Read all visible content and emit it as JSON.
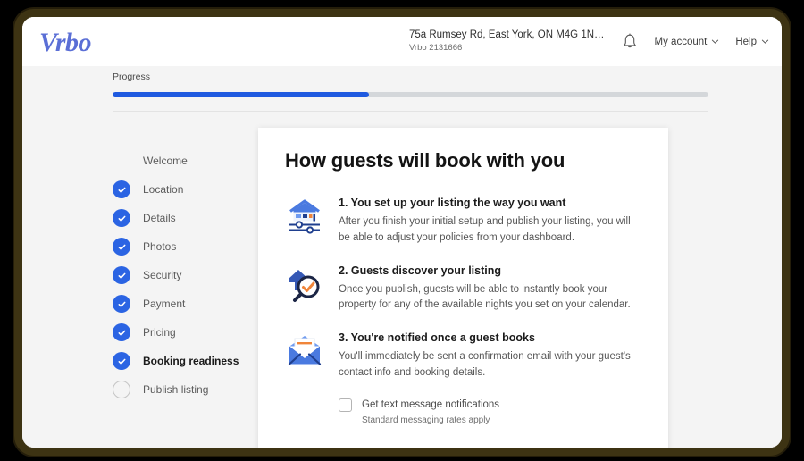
{
  "brand": {
    "name": "Vrbo"
  },
  "header": {
    "listing_address": "75a Rumsey Rd, East York, ON M4G 1N…",
    "listing_id": "Vrbo 2131666",
    "notifications_icon": "bell-icon",
    "account_menu": "My account",
    "help_menu": "Help"
  },
  "progress": {
    "label": "Progress",
    "percent": 43
  },
  "sidebar": {
    "items": [
      {
        "label": "Welcome",
        "state": "none"
      },
      {
        "label": "Location",
        "state": "done"
      },
      {
        "label": "Details",
        "state": "done"
      },
      {
        "label": "Photos",
        "state": "done"
      },
      {
        "label": "Security",
        "state": "done"
      },
      {
        "label": "Payment",
        "state": "done"
      },
      {
        "label": "Pricing",
        "state": "done"
      },
      {
        "label": "Booking readiness",
        "state": "done",
        "current": true
      },
      {
        "label": "Publish listing",
        "state": "todo"
      }
    ]
  },
  "main": {
    "title": "How guests will book with you",
    "steps": [
      {
        "icon": "house-sliders-icon",
        "title": "1. You set up your listing the way you want",
        "desc": "After you finish your initial setup and publish your listing, you will be able to adjust your policies from your dashboard."
      },
      {
        "icon": "house-search-check-icon",
        "title": "2. Guests discover your listing",
        "desc": "Once you publish, guests will be able to instantly book your property for any of the available nights you set on your calendar."
      },
      {
        "icon": "envelope-icon",
        "title": "3. You're notified once a guest books",
        "desc": "You'll immediately be sent a confirmation email with your guest's contact info and booking details."
      }
    ],
    "sms_checkbox": {
      "label": "Get text message notifications",
      "note": "Standard messaging rates apply",
      "checked": false
    }
  },
  "colors": {
    "brand_blue": "#5b6fd6",
    "accent_blue": "#2b64e3",
    "progress_blue": "#1f5ae0",
    "accent_orange": "#f0853a",
    "navy": "#1f3f8f",
    "page_bg": "#f4f4f4",
    "frame": "#3d3313"
  }
}
